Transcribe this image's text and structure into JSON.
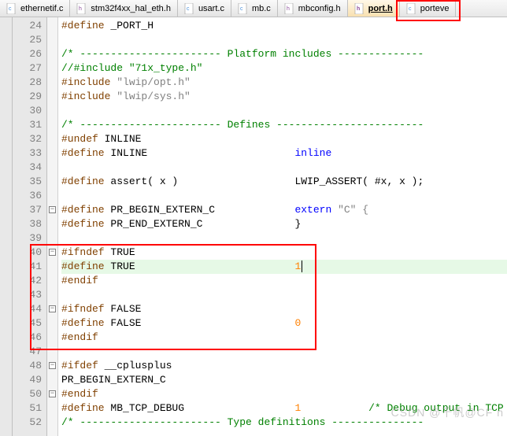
{
  "tabs": [
    {
      "label": "ethernetif.c",
      "type": "c"
    },
    {
      "label": "stm32f4xx_hal_eth.h",
      "type": "h"
    },
    {
      "label": "usart.c",
      "type": "c"
    },
    {
      "label": "mb.c",
      "type": "c"
    },
    {
      "label": "mbconfig.h",
      "type": "h"
    },
    {
      "label": "port.h",
      "type": "h",
      "active": true
    },
    {
      "label": "porteve",
      "type": "c"
    }
  ],
  "lines": {
    "24": {
      "pre": "#define",
      "rest": " _PORT_H"
    },
    "26": {
      "cmt": "/* ----------------------- Platform includes --------------"
    },
    "27": {
      "cmt": "//#include \"71x_type.h\""
    },
    "28": {
      "pre": "#include",
      "str": " \"lwip/opt.h\""
    },
    "29": {
      "pre": "#include",
      "str": " \"lwip/sys.h\""
    },
    "31": {
      "cmt": "/* ----------------------- Defines ------------------------"
    },
    "32": {
      "pre": "#undef",
      "rest": " INLINE"
    },
    "33": {
      "pre": "#define",
      "rest": " INLINE",
      "kw": "inline",
      "kwcol": 38
    },
    "35": {
      "pre": "#define",
      "rest": " assert( x )",
      "tail": "LWIP_ASSERT( #x, x );",
      "tailcol": 38
    },
    "37": {
      "pre": "#define",
      "rest": " PR_BEGIN_EXTERN_C",
      "kw": "extern",
      "kwtail": " \"C\" {",
      "kwcol": 38
    },
    "38": {
      "pre": "#define",
      "rest": " PR_END_EXTERN_C",
      "tail": "}",
      "tailcol": 38
    },
    "40": {
      "pre": "#ifndef",
      "rest": " TRUE"
    },
    "41": {
      "pre": "#define",
      "rest": " TRUE",
      "num": "1",
      "numcol": 38
    },
    "42": {
      "pre": "#endif"
    },
    "44": {
      "pre": "#ifndef",
      "rest": " FALSE"
    },
    "45": {
      "pre": "#define",
      "rest": " FALSE",
      "num": "0",
      "numcol": 38
    },
    "46": {
      "pre": "#endif"
    },
    "48": {
      "pre": "#ifdef",
      "rest": " __cplusplus"
    },
    "49": {
      "rest": "PR_BEGIN_EXTERN_C"
    },
    "50": {
      "pre": "#endif"
    },
    "51": {
      "pre": "#define",
      "rest": " MB_TCP_DEBUG",
      "num": "1",
      "numcol": 38,
      "cmt2": "/* Debug output in TCP m",
      "cmt2col": 50
    },
    "52": {
      "cmt": "/* ----------------------- Type definitions ---------------"
    }
  },
  "line_numbers": [
    24,
    25,
    26,
    27,
    28,
    29,
    30,
    31,
    32,
    33,
    34,
    35,
    36,
    37,
    38,
    39,
    40,
    41,
    42,
    43,
    44,
    45,
    46,
    47,
    48,
    49,
    50,
    51,
    52
  ],
  "fold_markers": [
    37,
    40,
    44,
    48,
    50
  ],
  "watermark": "CSDN @千帆@CF n"
}
